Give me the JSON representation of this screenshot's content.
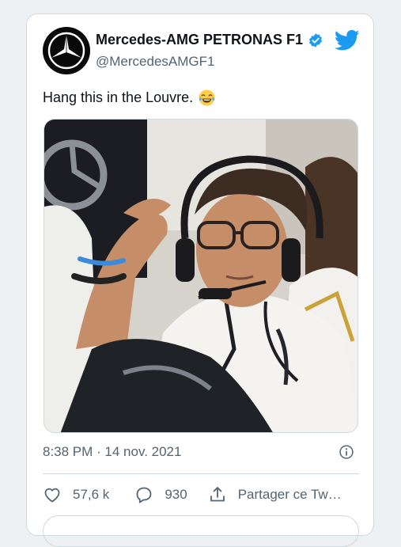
{
  "tweet": {
    "display_name": "Mercedes-AMG PETRONAS F1 ",
    "handle": "@MercedesAMGF1",
    "text": "Hang this in the Louvre.",
    "emoji": "face-with-tears-of-joy",
    "timestamp": "8:38 PM · 14 nov. 2021",
    "verified": true
  },
  "actions": {
    "likes": "57,6 k",
    "replies": "930",
    "share_label": "Partager ce Tw…"
  },
  "colors": {
    "accent": "#1d9bf0",
    "text": "#0f1419",
    "muted": "#536471",
    "border": "#cfd9de",
    "page_bg": "#eef1f3"
  },
  "icons": [
    "mercedes-star-icon",
    "verified-badge-icon",
    "twitter-bird-icon",
    "info-icon",
    "heart-icon",
    "reply-icon",
    "share-icon"
  ]
}
